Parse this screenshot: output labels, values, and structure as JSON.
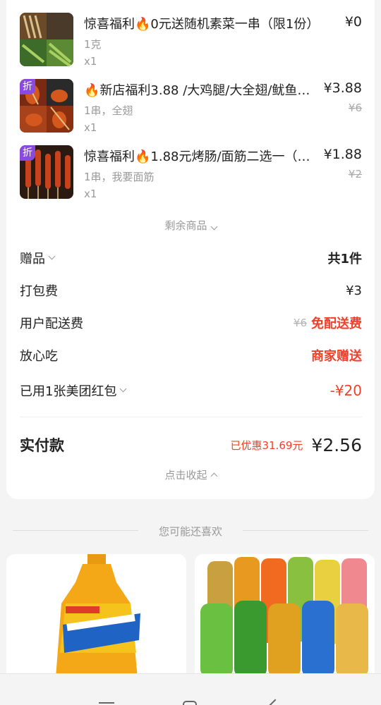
{
  "items": [
    {
      "name": "惊喜福利🔥0元送随机素菜一串（限1份）",
      "spec": "1克",
      "qty": "x1",
      "price": "¥0",
      "orig": "",
      "badge": ""
    },
    {
      "name": "🔥新店福利3.88 /大鸡腿/大全翅/鱿鱼…",
      "spec": "1串，全翅",
      "qty": "x1",
      "price": "¥3.88",
      "orig": "¥6",
      "badge": "折"
    },
    {
      "name": "惊喜福利🔥1.88元烤肠/面筋二选一（…",
      "spec": "1串，我要面筋",
      "qty": "x1",
      "price": "¥1.88",
      "orig": "¥2",
      "badge": "折"
    }
  ],
  "remaining_label": "剩余商品",
  "gift": {
    "label": "赠品",
    "value": "共1件"
  },
  "packing": {
    "label": "打包费",
    "value": "¥3"
  },
  "delivery": {
    "label": "用户配送费",
    "orig": "¥6",
    "value": "免配送费"
  },
  "safe": {
    "label": "放心吃",
    "value": "商家赠送"
  },
  "redpacket": {
    "label": "已用1张美团红包",
    "value": "-¥20"
  },
  "total": {
    "label": "实付款",
    "discount": "已优惠31.69元",
    "value": "¥2.56"
  },
  "collapse_label": "点击收起",
  "recommend_title": "您可能还喜欢",
  "colors": {
    "red": "#f0402a",
    "badge": "#8a4bdc"
  }
}
